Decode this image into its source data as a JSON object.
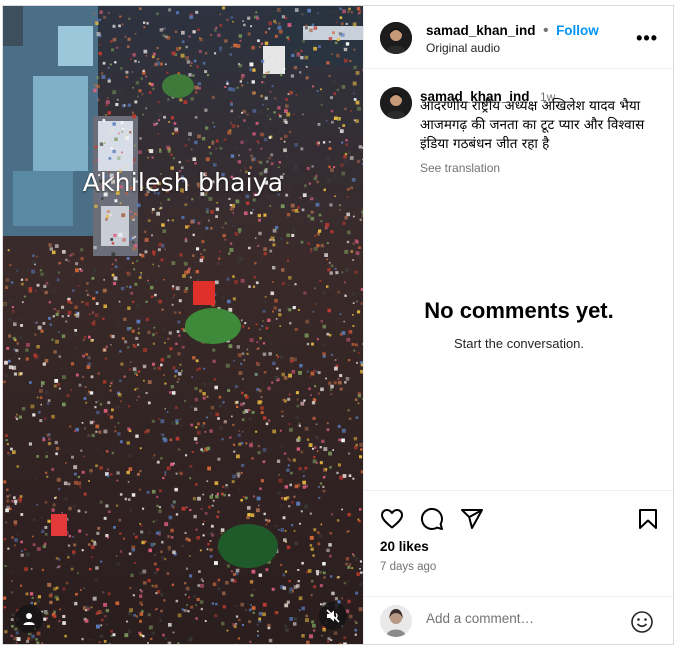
{
  "post": {
    "username": "samad_khan_ind",
    "follow_label": "Follow",
    "separator": "•",
    "audio_label": "Original audio",
    "more_label": "•••"
  },
  "media": {
    "overlay_text": "Akhilesh bhaiya",
    "tag_icon": "user-icon",
    "mute_icon": "speaker-muted-icon"
  },
  "caption": {
    "username": "samad_khan_ind",
    "time": "1w",
    "text": "आदरणीय राष्ट्रीय अध्यक्ष अखिलेश यादव भैया आजमगढ़ की जनता का टूट प्यार और विश्वास इंडिया गठबंधन जीत रहा है",
    "see_translation": "See translation"
  },
  "comments": {
    "empty_title": "No comments yet.",
    "empty_subtitle": "Start the conversation."
  },
  "actions": {
    "likes": "20 likes",
    "posted": "7 days ago",
    "icons": [
      "heart-icon",
      "comment-icon",
      "share-icon",
      "bookmark-icon"
    ]
  },
  "comment_box": {
    "placeholder": "Add a comment…",
    "emoji_icon": "smiley-icon"
  },
  "colors": {
    "link": "#0095f6",
    "muted": "#737373",
    "border": "#dbdbdb"
  }
}
